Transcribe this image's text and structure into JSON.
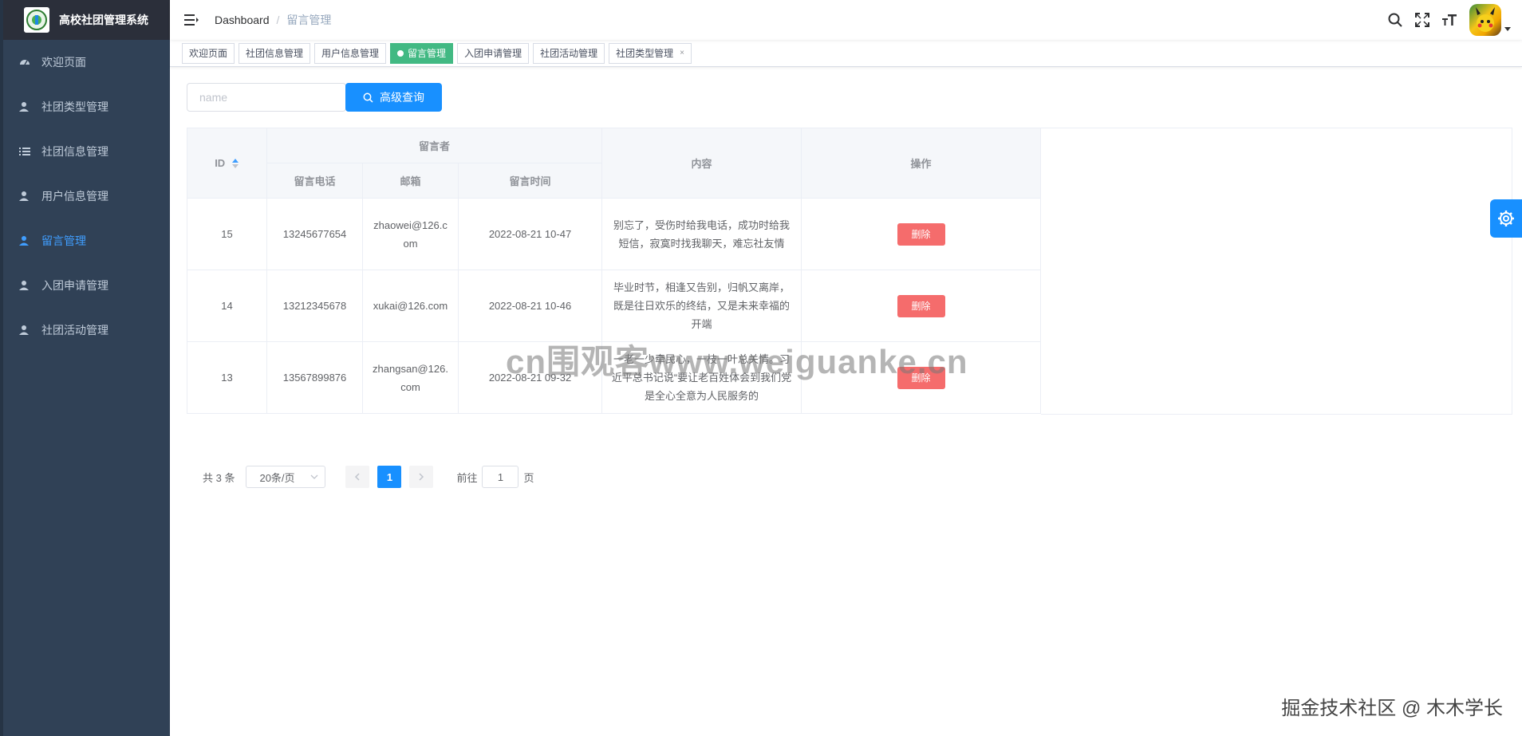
{
  "app": {
    "title": "高校社团管理系统"
  },
  "sidebar": {
    "items": [
      {
        "label": "欢迎页面",
        "icon": "dashboard-icon",
        "active": false
      },
      {
        "label": "社团类型管理",
        "icon": "user-icon",
        "active": false
      },
      {
        "label": "社团信息管理",
        "icon": "list-icon",
        "active": false
      },
      {
        "label": "用户信息管理",
        "icon": "user-icon",
        "active": false
      },
      {
        "label": "留言管理",
        "icon": "user-icon",
        "active": true
      },
      {
        "label": "入团申请管理",
        "icon": "user-icon",
        "active": false
      },
      {
        "label": "社团活动管理",
        "icon": "user-icon",
        "active": false
      }
    ]
  },
  "breadcrumb": {
    "root": "Dashboard",
    "separator": "/",
    "current": "留言管理"
  },
  "tags": [
    {
      "label": "欢迎页面",
      "active": false,
      "closable": false
    },
    {
      "label": "社团信息管理",
      "active": false,
      "closable": false
    },
    {
      "label": "用户信息管理",
      "active": false,
      "closable": false
    },
    {
      "label": "留言管理",
      "active": true,
      "closable": false
    },
    {
      "label": "入团申请管理",
      "active": false,
      "closable": false
    },
    {
      "label": "社团活动管理",
      "active": false,
      "closable": false
    },
    {
      "label": "社团类型管理",
      "active": false,
      "closable": true
    }
  ],
  "search": {
    "placeholder": "name",
    "button_label": "高级查询"
  },
  "table": {
    "headers": {
      "id": "ID",
      "group": "留言者",
      "phone": "留言电话",
      "email": "邮箱",
      "time": "留言时间",
      "content": "内容",
      "actions": "操作"
    },
    "rows": [
      {
        "id": "15",
        "phone": "13245677654",
        "email": "zhaowei@126.com",
        "time": "2022-08-21 10-47",
        "content": "别忘了，受伤时给我电话，成功时给我短信，寂寞时找我聊天，难忘社友情",
        "action": "删除"
      },
      {
        "id": "14",
        "phone": "13212345678",
        "email": "xukai@126.com",
        "time": "2022-08-21 10-46",
        "content": "毕业时节，相逢又告别，归帆又离岸，既是往日欢乐的终结，又是未来幸福的开端",
        "action": "删除"
      },
      {
        "id": "13",
        "phone": "13567899876",
        "email": "zhangsan@126.com",
        "time": "2022-08-21 09-32",
        "content": "一老一少牵民心，一枝一叶总关情。习近平总书记说“要让老百姓体会到我们党是全心全意为人民服务的",
        "action": "删除"
      }
    ]
  },
  "pagination": {
    "total": "共 3 条",
    "page_size": "20条/页",
    "current_page": "1",
    "goto_prefix": "前往",
    "goto_value": "1",
    "goto_suffix": "页"
  },
  "watermark": "cn围观客www.weiguanke.cn",
  "footer_watermark": "掘金技术社区 @ 木木学长",
  "colors": {
    "sidebar_bg": "#304156",
    "active": "#409eff",
    "primary": "#1890ff",
    "danger": "#f56c6c",
    "tag_active": "#42b983"
  }
}
